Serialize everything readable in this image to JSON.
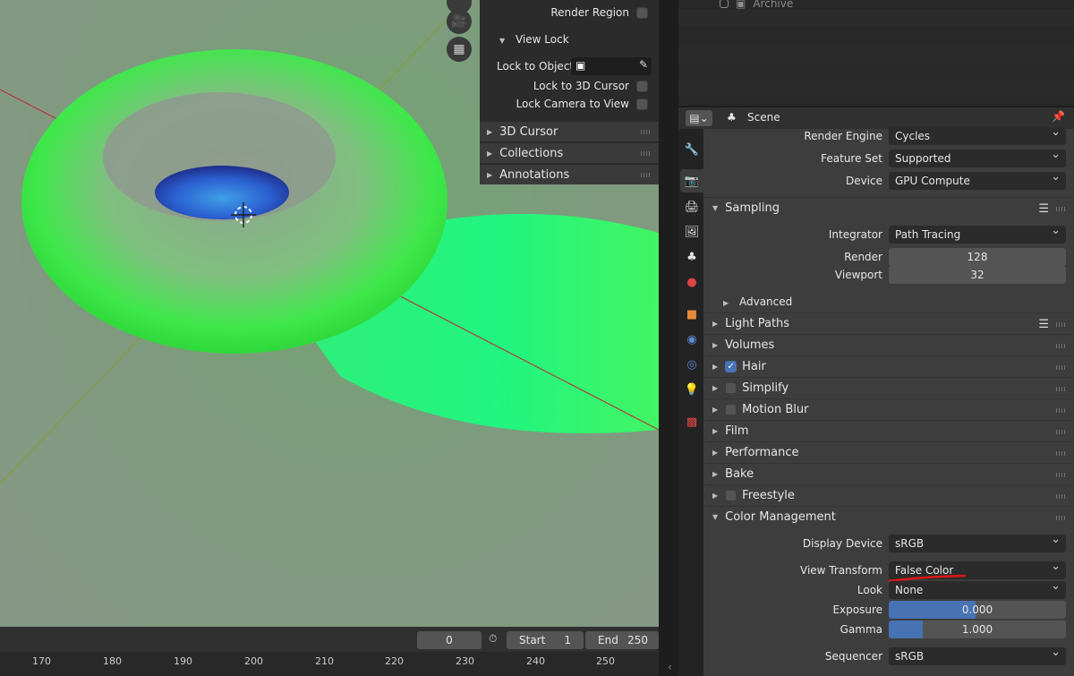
{
  "npanel": {
    "render_region": "Render Region",
    "view_lock": "View Lock",
    "lock_to_object": "Lock to Object",
    "lock_to_cursor": "Lock to 3D Cursor",
    "lock_camera": "Lock Camera to View",
    "sections": [
      "3D Cursor",
      "Collections",
      "Annotations"
    ]
  },
  "outliner": {
    "item": "Archive"
  },
  "properties": {
    "header_title": "Scene",
    "render_engine_label": "Render Engine",
    "render_engine": "Cycles",
    "feature_set_label": "Feature Set",
    "feature_set": "Supported",
    "device_label": "Device",
    "device": "GPU Compute",
    "sampling": "Sampling",
    "integrator_label": "Integrator",
    "integrator": "Path Tracing",
    "render_label": "Render",
    "render_samples": "128",
    "viewport_label": "Viewport",
    "viewport_samples": "32",
    "advanced": "Advanced",
    "panels": {
      "light_paths": "Light Paths",
      "volumes": "Volumes",
      "hair": "Hair",
      "simplify": "Simplify",
      "motion_blur": "Motion Blur",
      "film": "Film",
      "performance": "Performance",
      "bake": "Bake",
      "freestyle": "Freestyle",
      "color_management": "Color Management"
    },
    "display_device_label": "Display Device",
    "display_device": "sRGB",
    "view_transform_label": "View Transform",
    "view_transform": "False Color",
    "look_label": "Look",
    "look": "None",
    "exposure_label": "Exposure",
    "exposure": "0.000",
    "exposure_fill": 0.49,
    "gamma_label": "Gamma",
    "gamma": "1.000",
    "gamma_fill": 0.19,
    "sequencer_label": "Sequencer",
    "sequencer": "sRGB"
  },
  "timeline": {
    "current_frame": "0",
    "start_label": "Start",
    "start": "1",
    "end_label": "End",
    "end": "250",
    "ticks": [
      "170",
      "180",
      "190",
      "200",
      "210",
      "220",
      "230",
      "240",
      "250"
    ]
  },
  "colors": {
    "accent": "#4772b3",
    "annotation_red": "#e01515"
  }
}
